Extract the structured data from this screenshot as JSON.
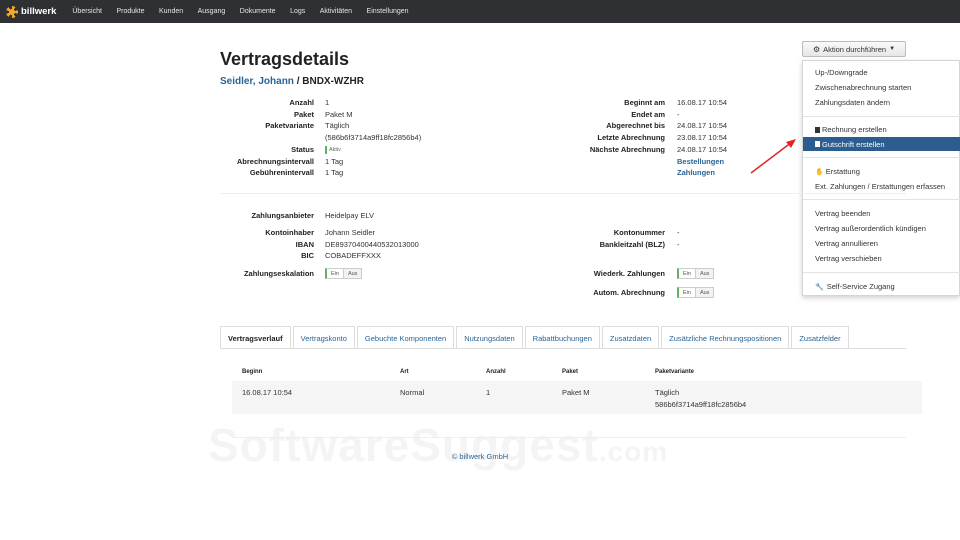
{
  "nav": {
    "logo": "billwerk",
    "items": [
      "Übersicht",
      "Produkte",
      "Kunden",
      "Ausgang",
      "Dokumente",
      "Logs",
      "Aktivitäten",
      "Einstellungen"
    ]
  },
  "header": {
    "title": "Vertragsdetails",
    "customer_link": "Seidler, Johann",
    "separator": " / ",
    "contract_id": "BNDX-WZHR"
  },
  "action_button": {
    "label": "Aktion durchführen"
  },
  "menu": {
    "items": [
      "Up-/Downgrade",
      "Zwischenabrechnung starten",
      "Zahlungsdaten ändern",
      "Rechnung erstellen",
      "Gutschrift erstellen",
      "Erstattung",
      "Ext. Zahlungen / Erstattungen erfassen",
      "Vertrag beenden",
      "Vertrag außerordentlich kündigen",
      "Vertrag annullieren",
      "Vertrag verschieben",
      "Self-Service Zugang"
    ]
  },
  "details_left": {
    "anzahl_label": "Anzahl",
    "anzahl": "1",
    "paket_label": "Paket",
    "paket": "Paket M",
    "paketvariante_label": "Paketvariante",
    "paketvariante": "Täglich",
    "paketvariante_id": "(586b6f3714a9ff18fc2856b4)",
    "status_label": "Status",
    "status": "Aktiv",
    "abrechnungsintervall_label": "Abrechnungsintervall",
    "abrechnungsintervall": "1 Tag",
    "gebuehrenintervall_label": "Gebührenintervall",
    "gebuehrenintervall": "1 Tag"
  },
  "details_right": {
    "beginnt_label": "Beginnt am",
    "beginnt": "16.08.17 10:54",
    "endet_label": "Endet am",
    "endet": "-",
    "abgerechnet_label": "Abgerechnet bis",
    "abgerechnet": "24.08.17 10:54",
    "letzte_label": "Letzte Abrechnung",
    "letzte": "23.08.17 10:54",
    "naechste_label": "Nächste Abrechnung",
    "naechste": "24.08.17 10:54",
    "bestellungen": "Bestellungen",
    "zahlungen": "Zahlungen"
  },
  "payment": {
    "anbieter_label": "Zahlungsanbieter",
    "anbieter": "Heidelpay ELV",
    "inhaber_label": "Kontoinhaber",
    "inhaber": "Johann Seidler",
    "iban_label": "IBAN",
    "iban": "DE89370400440532013000",
    "bic_label": "BIC",
    "bic": "COBADEFFXXX",
    "eskalation_label": "Zahlungseskalation",
    "kontonummer_label": "Kontonummer",
    "kontonummer": "-",
    "blz_label": "Bankleitzahl (BLZ)",
    "blz": "-",
    "wiederk_label": "Wiederk. Zahlungen",
    "autom_label": "Autom. Abrechnung",
    "toggle_on": "Ein",
    "toggle_off": "Aus"
  },
  "tabs": [
    "Vertragsverlauf",
    "Vertragskonto",
    "Gebuchte Komponenten",
    "Nutzungsdaten",
    "Rabattbuchungen",
    "Zusatzdaten",
    "Zusätzliche Rechnungspositionen",
    "Zusatzfelder"
  ],
  "table": {
    "headers": [
      "Beginn",
      "Art",
      "Anzahl",
      "Paket",
      "Paketvariante"
    ],
    "row": {
      "beginn": "16.08.17 10:54",
      "art": "Normal",
      "anzahl": "1",
      "paket": "Paket M",
      "variante": "Täglich",
      "variante_id": "586b6f3714a9ff18fc2856b4"
    }
  },
  "footer": "© billwerk GmbH",
  "watermark": {
    "main": "SoftwareSuggest",
    "suffix": ".com"
  },
  "colors": {
    "nav_bg": "#2e3033",
    "link": "#2a6496",
    "active_menu": "#2d5d8e",
    "toggle_on": "#5cb85c",
    "arrow": "#e02424"
  }
}
